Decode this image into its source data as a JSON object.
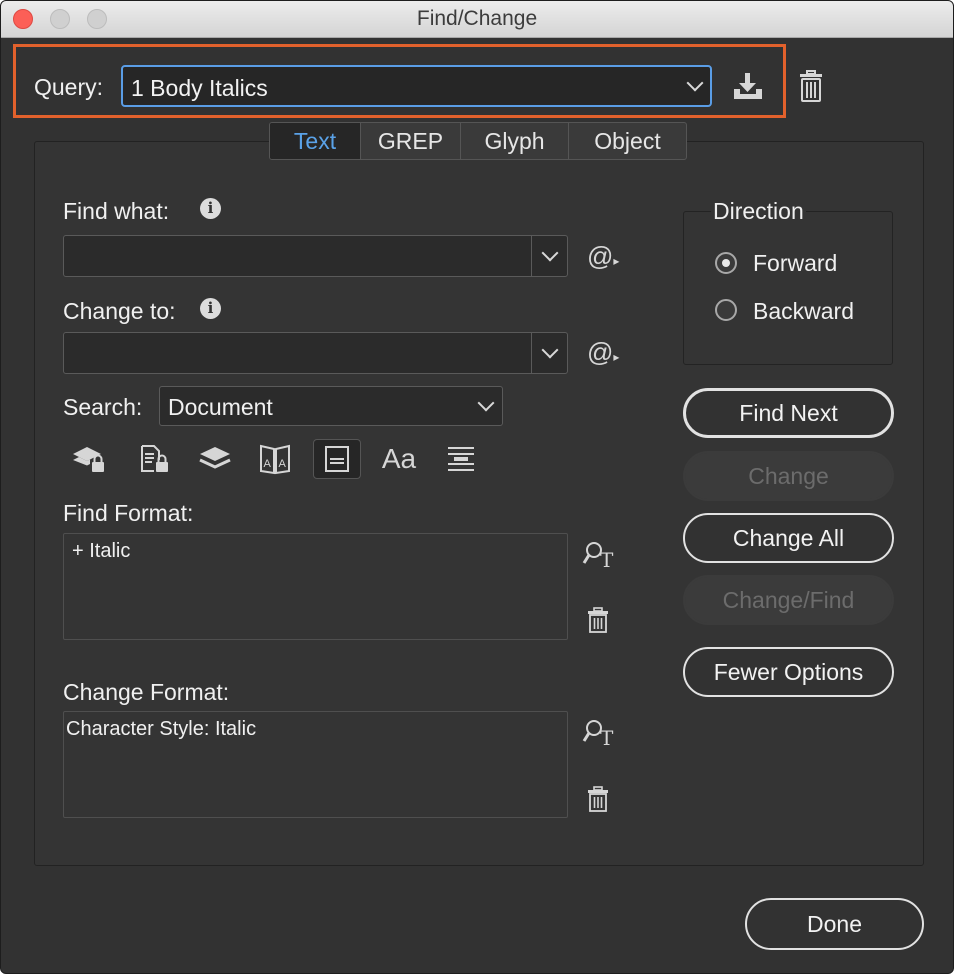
{
  "window": {
    "title": "Find/Change"
  },
  "query": {
    "label": "Query:",
    "value": "1 Body Italics"
  },
  "tabs": [
    {
      "label": "Text",
      "active": true
    },
    {
      "label": "GREP"
    },
    {
      "label": "Glyph"
    },
    {
      "label": "Object"
    }
  ],
  "find": {
    "label": "Find what:",
    "value": ""
  },
  "change": {
    "label": "Change to:",
    "value": ""
  },
  "search": {
    "label": "Search:",
    "value": "Document"
  },
  "options": {
    "case_label": "Aa"
  },
  "find_format": {
    "label": "Find Format:",
    "value": "+ Italic"
  },
  "change_format": {
    "label": "Change Format:",
    "value": "Character Style: Italic"
  },
  "direction": {
    "label": "Direction",
    "forward": "Forward",
    "backward": "Backward",
    "selected": "Forward"
  },
  "buttons": {
    "find_next": "Find Next",
    "change": "Change",
    "change_all": "Change All",
    "change_find": "Change/Find",
    "fewer_options": "Fewer Options",
    "done": "Done"
  },
  "colors": {
    "accent": "#5aa2e8",
    "highlight": "#e2612c",
    "background": "#323232"
  }
}
